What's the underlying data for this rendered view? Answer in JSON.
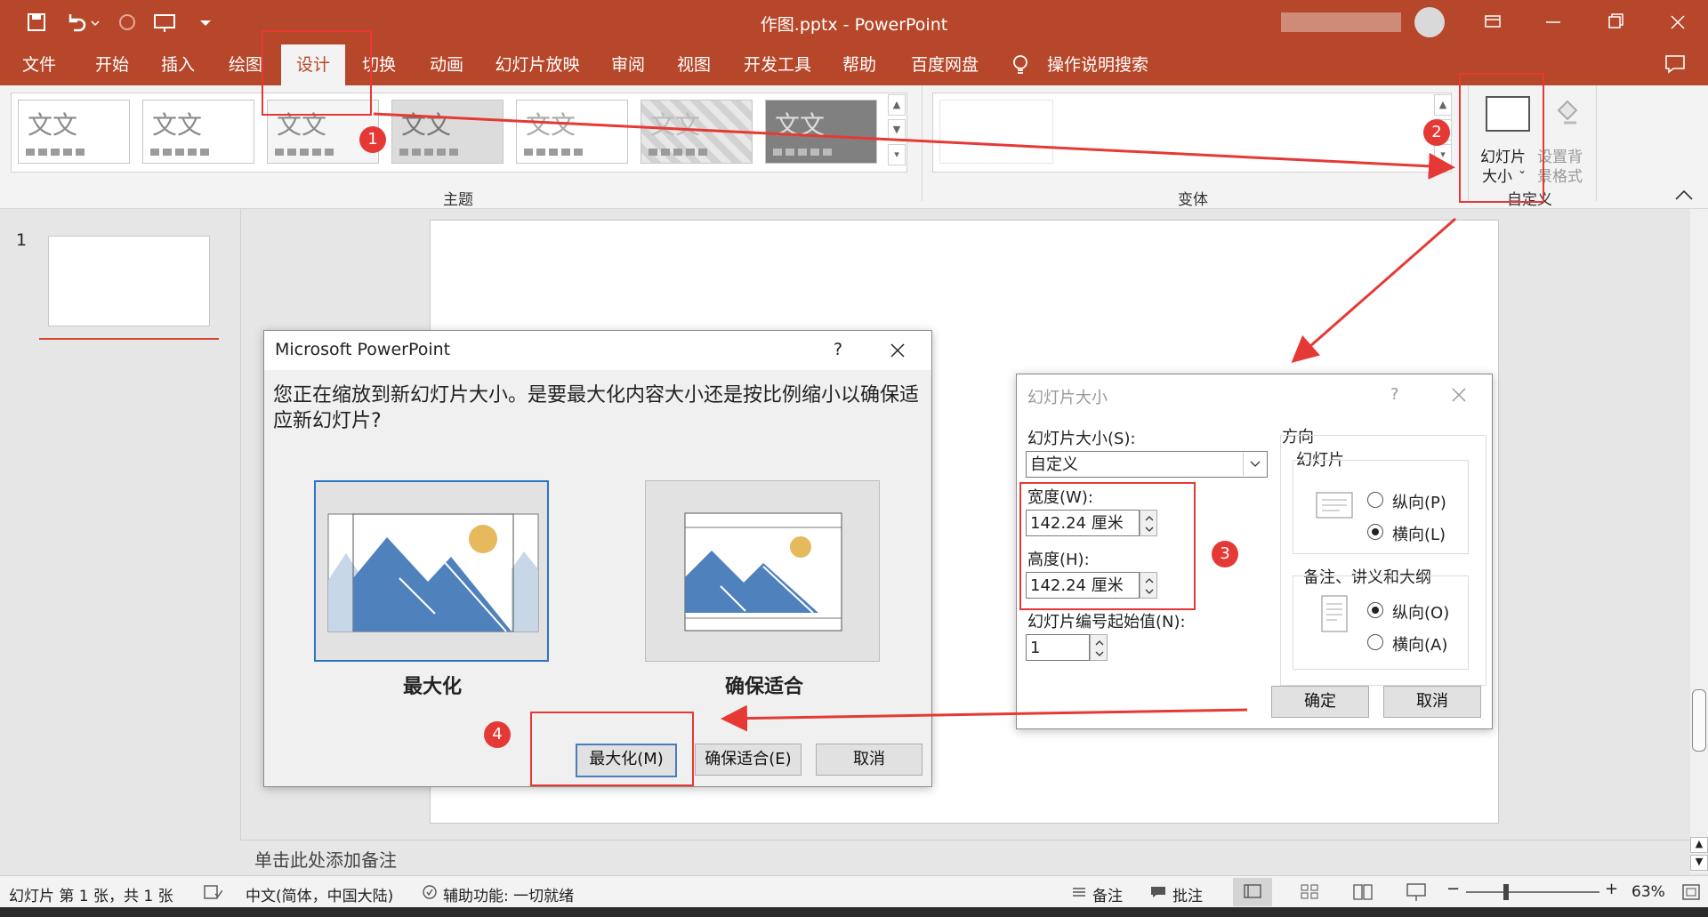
{
  "window": {
    "title": "作图.pptx  -  PowerPoint"
  },
  "tabs": [
    {
      "label": "文件"
    },
    {
      "label": "开始"
    },
    {
      "label": "插入"
    },
    {
      "label": "绘图"
    },
    {
      "label": "设计"
    },
    {
      "label": "切换"
    },
    {
      "label": "动画"
    },
    {
      "label": "幻灯片放映"
    },
    {
      "label": "审阅"
    },
    {
      "label": "视图"
    },
    {
      "label": "开发工具"
    },
    {
      "label": "帮助"
    },
    {
      "label": "百度网盘"
    }
  ],
  "tell_me": "操作说明搜索",
  "ribbon": {
    "theme_sample": "文文",
    "group_themes": "主题",
    "group_variants": "变体",
    "group_customize": "自定义",
    "slide_size_line1": "幻灯片",
    "slide_size_line2": "大小",
    "bg_format_line1": "设置背",
    "bg_format_line2": "景格式"
  },
  "thumbnails": {
    "slide_number": "1"
  },
  "notes_placeholder": "单击此处添加备注",
  "status": {
    "slide_count": "幻灯片 第 1 张，共 1 张",
    "language": "中文(简体，中国大陆)",
    "accessibility": "辅助功能: 一切就绪",
    "notes": "备注",
    "comments": "批注",
    "zoom": "63%"
  },
  "scale_dialog": {
    "title": "Microsoft PowerPoint",
    "help": "?",
    "message": "您正在缩放到新幻灯片大小。是要最大化内容大小还是按比例缩小以确保适应新幻灯片?",
    "option_max": "最大化",
    "option_fit": "确保适合",
    "btn_max": "最大化(M)",
    "btn_fit": "确保适合(E)",
    "btn_cancel": "取消"
  },
  "size_dialog": {
    "title": "幻灯片大小",
    "help": "?",
    "size_label": "幻灯片大小(S):",
    "size_value": "自定义",
    "width_label": "宽度(W):",
    "width_value": "142.24 厘米",
    "height_label": "高度(H):",
    "height_value": "142.24 厘米",
    "number_label": "幻灯片编号起始值(N):",
    "number_value": "1",
    "orientation": "方向",
    "slides": "幻灯片",
    "portrait_p": "纵向(P)",
    "landscape_l": "横向(L)",
    "notes_group": "备注、讲义和大纲",
    "portrait_o": "纵向(O)",
    "landscape_a": "横向(A)",
    "ok": "确定",
    "cancel": "取消"
  },
  "markers": [
    "1",
    "2",
    "3",
    "4"
  ],
  "colors": {
    "accent": "#b7472a",
    "annotation": "#e53935",
    "chart_blue": "#4f81bd",
    "sun": "#e6b95c"
  }
}
